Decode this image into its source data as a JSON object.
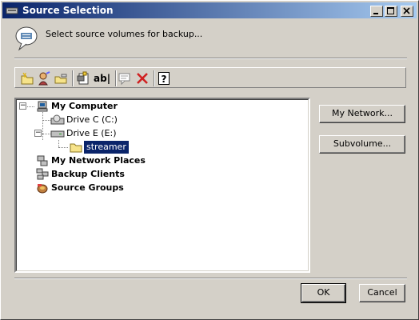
{
  "window": {
    "title": "Source Selection"
  },
  "header": {
    "instruction": "Select source volumes for backup..."
  },
  "toolbar": {
    "tools": [
      "new-folder-icon",
      "wizard-icon",
      "open-folder-icon",
      "properties-icon",
      "rename-icon",
      "comment-icon",
      "delete-icon",
      "help-icon"
    ],
    "rename_label": "ab|"
  },
  "tree": {
    "root": "My Computer",
    "drive_c": "Drive C (C:)",
    "drive_e": "Drive E (E:)",
    "streamer": "streamer",
    "network_places": "My Network Places",
    "backup_clients": "Backup Clients",
    "source_groups": "Source Groups"
  },
  "buttons": {
    "my_network": "My Network...",
    "subvolume": "Subvolume...",
    "ok": "OK",
    "cancel": "Cancel"
  },
  "colors": {
    "titlebar_start": "#0a246a",
    "titlebar_end": "#a6caf0",
    "selection": "#0a246a",
    "face": "#d4d0c8"
  }
}
